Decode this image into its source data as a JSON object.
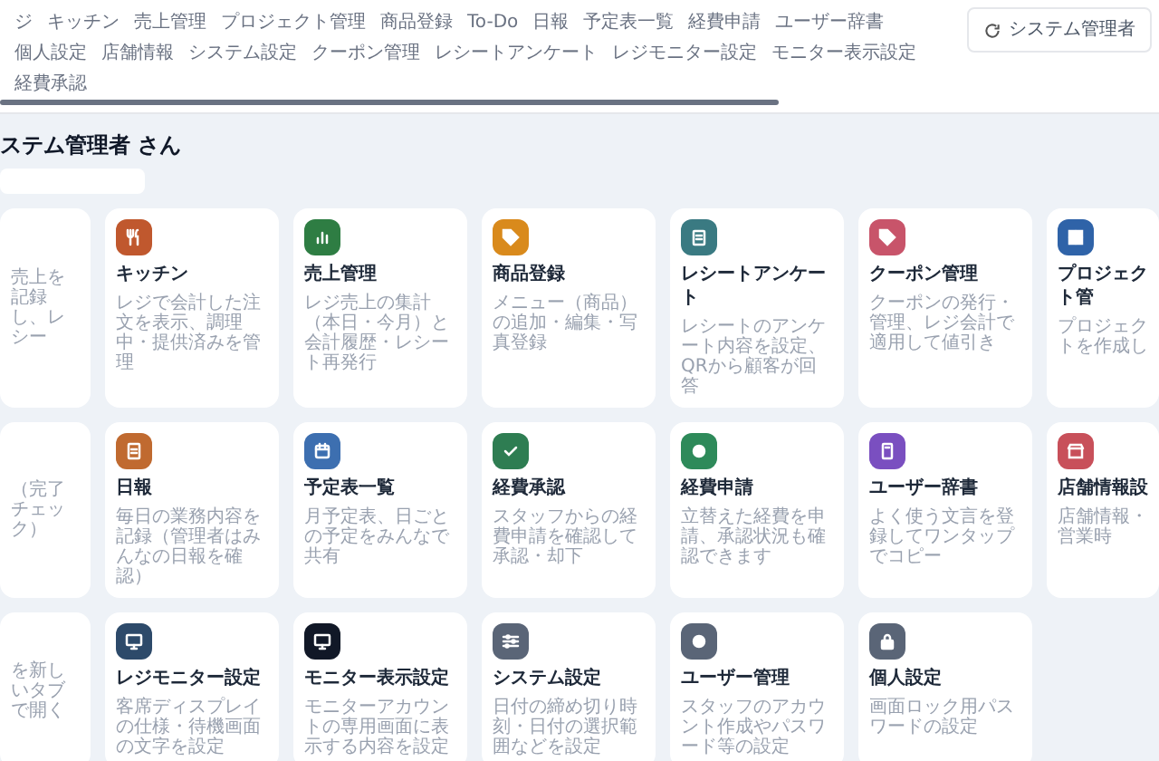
{
  "nav": {
    "tabs": [
      "ジ",
      "キッチン",
      "売上管理",
      "プロジェクト管理",
      "商品登録",
      "To-Do",
      "日報",
      "予定表一覧",
      "経費申請",
      "ユーザー辞書",
      "個人設定",
      "店舗情報",
      "システム設定",
      "クーポン管理",
      "レシートアンケート",
      "レジモニター設定",
      "モニター表示設定",
      "経費承認"
    ],
    "user_button": "システム管理者"
  },
  "greeting": "ステム管理者 さん",
  "cards": [
    {
      "description": "売上を記録し、レシー"
    },
    {
      "title": "キッチン",
      "description": "レジで会計した注文を表示、調理中・提供済みを管理",
      "color": "#c0582e"
    },
    {
      "title": "売上管理",
      "description": "レジ売上の集計（本日・今月）と会計履歴・レシート再発行",
      "color": "#2e7d43"
    },
    {
      "title": "商品登録",
      "description": "メニュー（商品）の追加・編集・写真登録",
      "color": "#d98a1c"
    },
    {
      "title": "レシートアンケート",
      "description": "レシートのアンケート内容を設定、QRから顧客が回答",
      "color": "#3a7a82"
    },
    {
      "title": "クーポン管理",
      "description": "クーポンの発行・管理、レジ会計で適用して値引き",
      "color": "#c8546a"
    },
    {
      "title": "プロジェクト管",
      "description": "プロジェクトを作成し",
      "color": "#2f63a8"
    },
    {
      "description": "（完了チェック）"
    },
    {
      "title": "日報",
      "description": "毎日の業務内容を記録（管理者はみんなの日報を確認）",
      "color": "#c06a30"
    },
    {
      "title": "予定表一覧",
      "description": "月予定表、日ごとの予定をみんなで共有",
      "color": "#3d6fb0"
    },
    {
      "title": "経費承認",
      "description": "スタッフからの経費申請を確認して承認・却下",
      "color": "#2e7d52"
    },
    {
      "title": "経費申請",
      "description": "立替えた経費を申請、承認状況も確認できます",
      "color": "#2e8a5a"
    },
    {
      "title": "ユーザー辞書",
      "description": "よく使う文言を登録してワンタップでコピー",
      "color": "#7a4fc0"
    },
    {
      "title": "店舗情報設",
      "description": "店舗情報・営業時",
      "color": "#c8505a"
    },
    {
      "description": "を新しいタブで開く"
    },
    {
      "title": "レジモニター設定",
      "description": "客席ディスプレイの仕様・待機画面の文字を設定",
      "color": "#2d4a6a"
    },
    {
      "title": "モニター表示設定",
      "description": "モニターアカウントの専用画面に表示する内容を設定",
      "color": "#111827"
    },
    {
      "title": "システム設定",
      "description": "日付の締め切り時刻・日付の選択範囲などを設定",
      "color": "#5a6577"
    },
    {
      "title": "ユーザー管理",
      "description": "スタッフのアカウント作成やパスワード等の設定",
      "color": "#5a6577"
    },
    {
      "title": "個人設定",
      "description": "画面ロック用パスワードの設定",
      "color": "#5a6577"
    }
  ]
}
